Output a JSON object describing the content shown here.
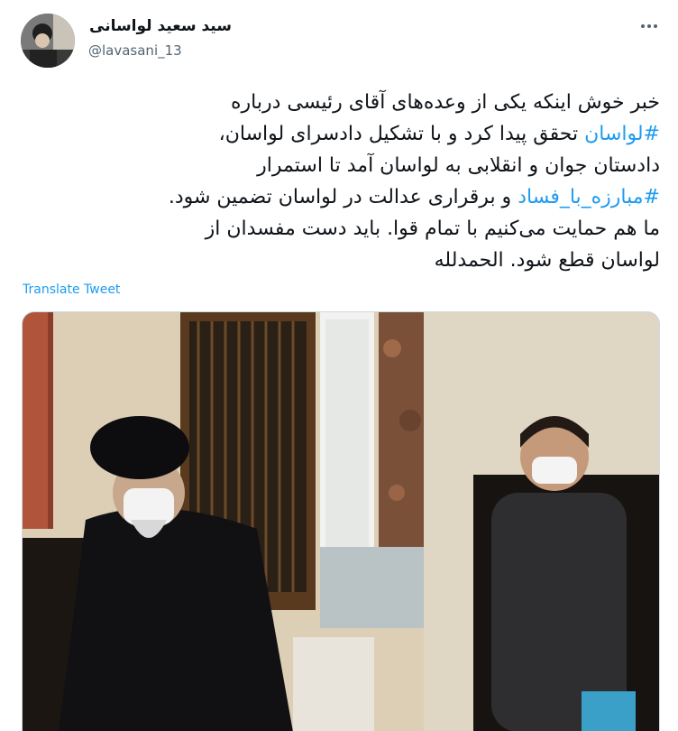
{
  "author": {
    "display_name": "سید سعید لواسانی",
    "handle": "@lavasani_13"
  },
  "tweet": {
    "line1": "خبر خوش اینکه یکی از وعده‌های آقای رئیسی درباره",
    "line2_tag": "#لواسان",
    "line2_rest": " تحقق پیدا کرد و با تشکیل دادسرای لواسان،",
    "line3": "دادستان جوان و انقلابی به لواسان آمد تا استمرار",
    "line4_tag": "#مبارزه_با_فساد",
    "line4_rest": " و برقراری عدالت در لواسان تضمین شود.",
    "line5": "ما هم حمایت می‌کنیم با تمام قوا. باید دست مفسدان از",
    "line6": "لواسان قطع شود. الحمدلله"
  },
  "translate_label": "Translate Tweet",
  "colors": {
    "link": "#1d9bf0",
    "text": "#0f1419",
    "secondary": "#536471"
  },
  "icons": {
    "more": "more-horizontal-icon"
  }
}
